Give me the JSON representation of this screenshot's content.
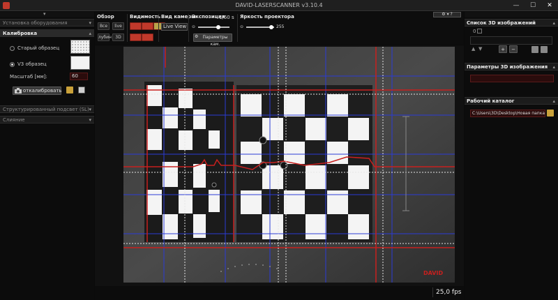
{
  "window": {
    "title": "DAVID-LASERSCANNER v3.10.4",
    "minimize": "—",
    "maximize": "☐",
    "close": "✕"
  },
  "left_panel": {
    "sections": [
      {
        "label": "Установка оборудования",
        "expanded": false
      },
      {
        "label": "Калибровка",
        "expanded": true
      },
      {
        "label": "Структурированный подсвет (SL)",
        "expanded": false
      },
      {
        "label": "Слияние",
        "expanded": false
      }
    ],
    "calibration": {
      "pattern_old": "Старый образец",
      "pattern_v3": "V3 образец",
      "selected": "V3 образец",
      "scale_label": "Масштаб [мм]:",
      "scale_value": "60",
      "calibrate_button": "откалибровать"
    }
  },
  "toolbar": {
    "overview": {
      "title": "Обзор",
      "btn_all": "Все",
      "btn_live": "live",
      "btn_depth": "лубин",
      "btn_3d": "3D"
    },
    "visibility": {
      "title": "Видимость"
    },
    "camera_view": {
      "title": "Вид камеры",
      "value": "Live View"
    },
    "exposure": {
      "title": "Экспозиция",
      "value": "1/60 s",
      "settings_button": "Параметры кам.",
      "level": 0.65
    },
    "projector": {
      "title": "Яркость проектора",
      "value": "255",
      "level": 0.9
    }
  },
  "viewport": {
    "watermark": "DAVID",
    "fps": "25,0 fps"
  },
  "right_panel": {
    "image_list": {
      "title": "Список 3D изображений",
      "item_index": "0"
    },
    "params": {
      "title": "Параметры 3D изображения"
    },
    "workdir": {
      "title": "Рабочий каталог",
      "path": "C:\\Users\\3D\\Desktop\\Новая папка"
    }
  },
  "colors": {
    "accent_red": "#c0392b",
    "field_red": "#2a0c0c",
    "blue_line": "#2b3bd6",
    "red_line": "#c8201e"
  }
}
